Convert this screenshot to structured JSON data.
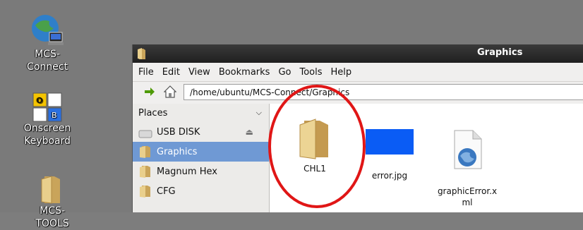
{
  "desktop": {
    "icons": [
      {
        "label": "MCS-\nConnect",
        "icon": "globe-computer-icon"
      },
      {
        "label": "Onscreen\nKeyboard",
        "icon": "keyboard-icon",
        "keys": [
          "O",
          "B"
        ]
      },
      {
        "label": "MCS-TOOLS",
        "icon": "folder-icon"
      }
    ]
  },
  "window": {
    "title": "Graphics",
    "menu": [
      "File",
      "Edit",
      "View",
      "Bookmarks",
      "Go",
      "Tools",
      "Help"
    ],
    "location": "/home/ubuntu/MCS-Connect/Graphics",
    "sidebar": {
      "header": "Places",
      "items": [
        "USB DISK",
        "Graphics",
        "Magnum Hex",
        "CFG"
      ]
    },
    "files": [
      {
        "name": "CHL1",
        "icon": "folder-icon"
      },
      {
        "name": "error.jpg",
        "icon": "image-icon"
      },
      {
        "name": "graphicError.x\nml",
        "icon": "xml-file-icon"
      }
    ]
  },
  "colors": {
    "selection": "#6f99d4",
    "annotation_circle": "#e01616",
    "thumbnail": "#0a5cf5"
  }
}
